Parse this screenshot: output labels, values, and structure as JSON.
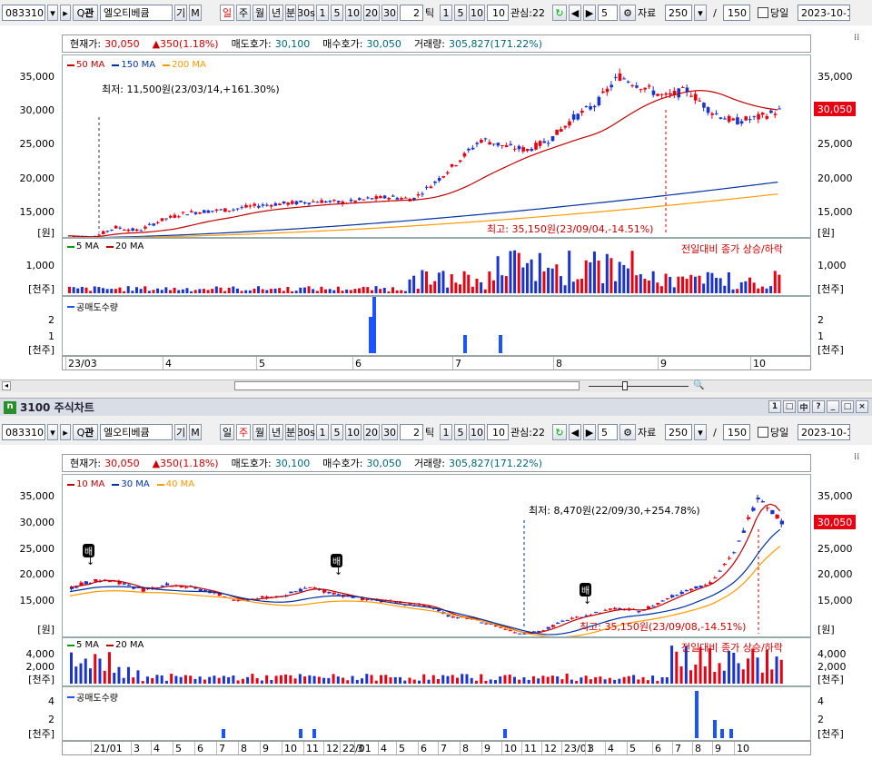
{
  "toolbar": {
    "code": "083310",
    "name": "엘오티베큠",
    "gi": "기",
    "m": "M",
    "periods": [
      "일",
      "주",
      "월",
      "년",
      "분"
    ],
    "sec": "30s",
    "nums": [
      "1",
      "5",
      "10",
      "20",
      "30"
    ],
    "tick_field": "2",
    "tick": "틱",
    "tick_nums": [
      "1",
      "5",
      "10"
    ],
    "tick_field2": "10",
    "interest": "관심:22",
    "interest_num": "5",
    "data_label": "자료",
    "data_count": "250",
    "slash": "/",
    "page": "150",
    "today": "당일",
    "date": "2023-10-1",
    "q": "Q",
    "gwan": "관"
  },
  "top": {
    "info": {
      "current_label": "현재가:",
      "current": "30,050",
      "change": "▲350(1.18%)",
      "ask_label": "매도호가:",
      "ask": "30,100",
      "bid_label": "매수호가:",
      "bid": "30,050",
      "vol_label": "거래량:",
      "vol": "305,827(171.22%)"
    },
    "ma_legend": [
      "50 MA",
      "150 MA",
      "200 MA"
    ],
    "price_axis": [
      "35,000",
      "30,000",
      "25,000",
      "20,000",
      "15,000",
      "[원]"
    ],
    "low_annot": "최저: 11,500원(23/03/14,+161.30%)",
    "high_annot": "최고: 35,150원(23/09/04,-14.51%)",
    "price_tag": "30,050",
    "vol_legend": [
      "5 MA",
      "20 MA"
    ],
    "vol_note": "전일대비 종가 상승/하락",
    "vol_axis": [
      "1,000",
      "[천주]"
    ],
    "short_legend": "공매도수량",
    "short_axis": [
      "2",
      "1",
      "[천주]"
    ],
    "x_labels": [
      "23/03",
      "4",
      "5",
      "6",
      "7",
      "8",
      "9",
      "10"
    ]
  },
  "window_title": "3100 주식차트",
  "window_buttons": [
    "1",
    "□",
    "中",
    "?",
    "_",
    "□",
    "×"
  ],
  "bottom": {
    "info": {
      "current_label": "현재가:",
      "current": "30,050",
      "change": "▲350(1.18%)",
      "ask_label": "매도호가:",
      "ask": "30,100",
      "bid_label": "매수호가:",
      "bid": "30,050",
      "vol_label": "거래량:",
      "vol": "305,827(171.22%)"
    },
    "ma_legend": [
      "10 MA",
      "30 MA",
      "40 MA"
    ],
    "price_axis": [
      "35,000",
      "30,000",
      "25,000",
      "20,000",
      "15,000",
      "[원]"
    ],
    "low_annot": "최저: 8,470원(22/09/30,+254.78%)",
    "high_annot": "최고: 35,150원(23/09/08,-14.51%)",
    "price_tag": "30,050",
    "badge": "배",
    "vol_legend": [
      "5 MA",
      "20 MA"
    ],
    "vol_note": "전일대비 종가 상승/하락",
    "vol_axis": [
      "4,000",
      "2,000",
      "[천주]"
    ],
    "short_legend": "공매도수량",
    "short_axis": [
      "4",
      "2",
      "[천주]"
    ],
    "x_labels": [
      "21/01",
      "3",
      "4",
      "5",
      "6",
      "7",
      "8",
      "9",
      "10",
      "11",
      "12",
      "22/01",
      "3",
      "4",
      "5",
      "6",
      "7",
      "8",
      "9",
      "10",
      "11",
      "12",
      "23/01",
      "3",
      "4",
      "5",
      "6",
      "7",
      "8",
      "9",
      "10"
    ]
  },
  "colors": {
    "up": "#e60012",
    "down": "#1a33cc",
    "ma_red": "#c00000",
    "ma_blue": "#0032a0",
    "ma_orange": "#ff9900"
  }
}
